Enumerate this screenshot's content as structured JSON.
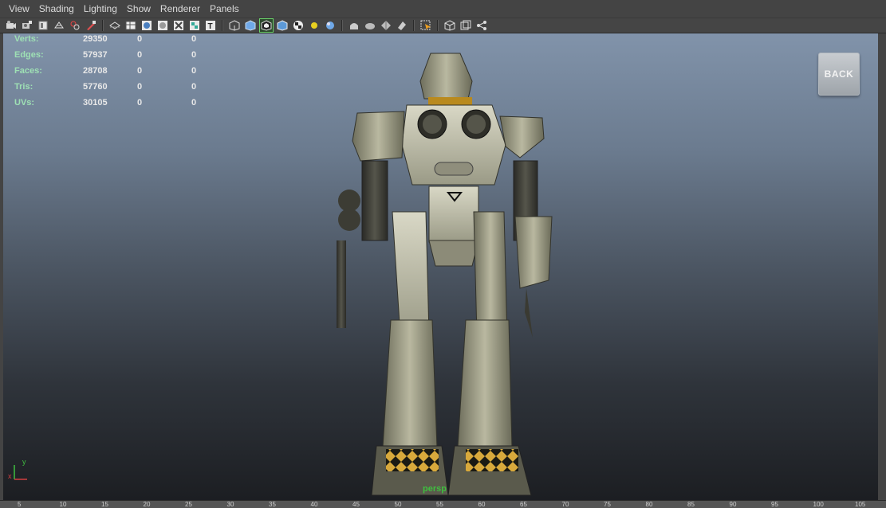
{
  "menu": [
    "View",
    "Shading",
    "Lighting",
    "Show",
    "Renderer",
    "Panels"
  ],
  "toolbar_icons": [
    "camera-attributes-icon",
    "bookmark-icon",
    "image-plane-icon",
    "grid-icon",
    "film-gate-icon",
    "resolution-gate-icon",
    "wireframe-icon",
    "smooth-shade-icon",
    "flat-shade-icon",
    "bounding-box-icon",
    "points-icon",
    "shaded-icon",
    "wireframe-on-shaded-icon",
    "xray-icon",
    "texture-icon",
    "default-lighting-icon",
    "light-bulb-icon",
    "shadow-icon",
    "isolate-select-icon",
    "xray-joints-icon",
    "xray-active-icon",
    "backface-icon",
    "select-camera-icon",
    "frame-all-icon",
    "frame-selection-icon",
    "ambient-occlusion-icon"
  ],
  "hud": {
    "rows": [
      {
        "label": "Verts:",
        "v1": "29350",
        "v2": "0",
        "v3": "0"
      },
      {
        "label": "Edges:",
        "v1": "57937",
        "v2": "0",
        "v3": "0"
      },
      {
        "label": "Faces:",
        "v1": "28708",
        "v2": "0",
        "v3": "0"
      },
      {
        "label": "Tris:",
        "v1": "57760",
        "v2": "0",
        "v3": "0"
      },
      {
        "label": "UVs:",
        "v1": "30105",
        "v2": "0",
        "v3": "0"
      }
    ]
  },
  "back_label": "BACK",
  "camera_label": "persp",
  "axis": {
    "y": "y",
    "x": "x"
  },
  "timeline_ticks": [
    "5",
    "10",
    "15",
    "20",
    "25",
    "30",
    "35",
    "40",
    "45",
    "50",
    "55",
    "60",
    "65",
    "70",
    "75",
    "80",
    "85",
    "90",
    "95",
    "100",
    "105"
  ],
  "colors": {
    "hud_label": "#9ee0b4",
    "camera_label": "#3fbf3f",
    "active_outline": "#6bd36b"
  }
}
